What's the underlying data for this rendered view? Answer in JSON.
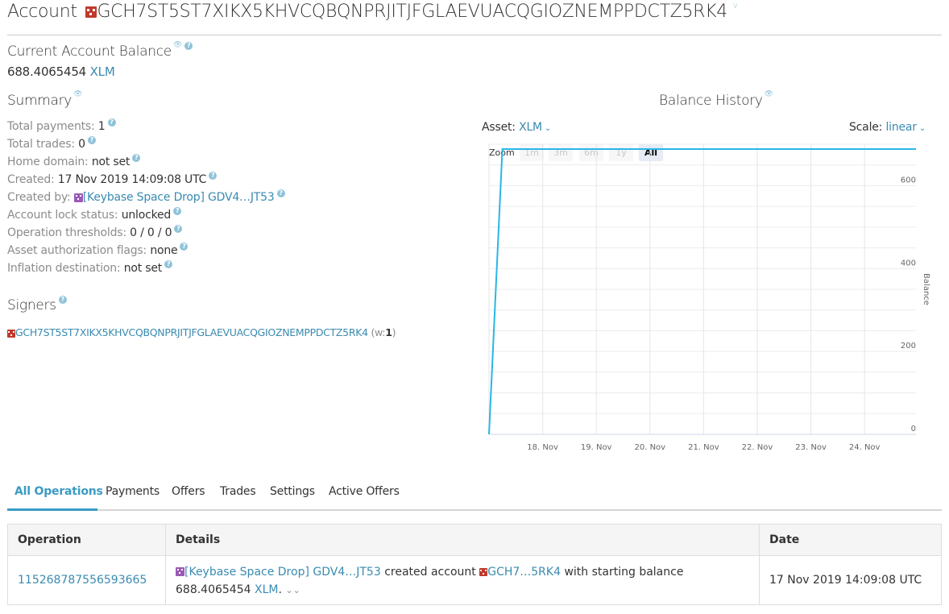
{
  "header": {
    "title_prefix": "Account",
    "account_id": "GCH7ST5ST7XIKX5KHVCQBQNPRJITJFGLAEVUACQGIOZNEMPPDCTZ5RK4",
    "title_suffix": "v"
  },
  "balance": {
    "label": "Current Account Balance",
    "amount": "688.4065454",
    "asset": "XLM"
  },
  "summary": {
    "title": "Summary",
    "rows": [
      {
        "label": "Total payments:",
        "value": "1"
      },
      {
        "label": "Total trades:",
        "value": "0"
      },
      {
        "label": "Home domain:",
        "value": "not set"
      },
      {
        "label": "Created:",
        "value": "17 Nov 2019 14:09:08 UTC"
      },
      {
        "label": "Created by:",
        "value": "[Keybase Space Drop] GDV4…JT53"
      },
      {
        "label": "Account lock status:",
        "value": "unlocked"
      },
      {
        "label": "Operation thresholds:",
        "value": "0 / 0 / 0"
      },
      {
        "label": "Asset authorization flags:",
        "value": "none"
      },
      {
        "label": "Inflation destination:",
        "value": "not set"
      }
    ]
  },
  "signers": {
    "title": "Signers",
    "key": "GCH7ST5ST7XIKX5KHVCQBQNPRJITJFGLAEVUACQGIOZNEMPPDCTZ5RK4",
    "weight_prefix": "(w:",
    "weight": "1",
    "weight_suffix": ")"
  },
  "history": {
    "title": "Balance History",
    "asset_label": "Asset:",
    "asset_value": "XLM",
    "scale_label": "Scale:",
    "scale_value": "linear",
    "zoom_label": "Zoom",
    "zoom_options": [
      "1m",
      "3m",
      "6m",
      "1y",
      "All"
    ],
    "zoom_selected": "All"
  },
  "chart_data": {
    "type": "line",
    "ylabel": "Balance",
    "ylim": [
      0,
      700
    ],
    "yticks": [
      0,
      200,
      400,
      600
    ],
    "xticks": [
      "18. Nov",
      "19. Nov",
      "20. Nov",
      "21. Nov",
      "22. Nov",
      "23. Nov",
      "24. Nov"
    ],
    "xlim": [
      "2019-11-17",
      "2019-11-24T23:00"
    ],
    "grid": true,
    "series": [
      {
        "color": "#29b6e8",
        "x": [
          "2019-11-17T00:00",
          "2019-11-17T06:00",
          "2019-11-24T23:00"
        ],
        "y": [
          0,
          688.4,
          688.4
        ]
      }
    ]
  },
  "tabs": [
    "All Operations",
    "Payments",
    "Offers",
    "Trades",
    "Settings",
    "Active Offers"
  ],
  "operations": {
    "headers": [
      "Operation",
      "Details",
      "Date"
    ],
    "rows": [
      {
        "id": "115268787556593665",
        "from": "[Keybase Space Drop] GDV4…JT53",
        "action": "created account",
        "to": "GCH7…5RK4",
        "middle": "with starting balance",
        "amount": "688.4065454",
        "asset": "XLM",
        "date": "17 Nov 2019 14:09:08 UTC"
      }
    ]
  }
}
